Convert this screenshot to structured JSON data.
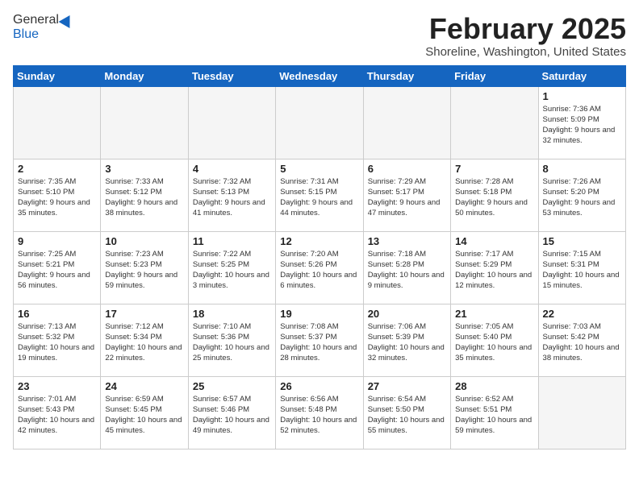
{
  "header": {
    "logo": {
      "general": "General",
      "blue": "Blue"
    },
    "title": "February 2025",
    "location": "Shoreline, Washington, United States"
  },
  "days_of_week": [
    "Sunday",
    "Monday",
    "Tuesday",
    "Wednesday",
    "Thursday",
    "Friday",
    "Saturday"
  ],
  "weeks": [
    [
      {
        "day": "",
        "info": ""
      },
      {
        "day": "",
        "info": ""
      },
      {
        "day": "",
        "info": ""
      },
      {
        "day": "",
        "info": ""
      },
      {
        "day": "",
        "info": ""
      },
      {
        "day": "",
        "info": ""
      },
      {
        "day": "1",
        "info": "Sunrise: 7:36 AM\nSunset: 5:09 PM\nDaylight: 9 hours and 32 minutes."
      }
    ],
    [
      {
        "day": "2",
        "info": "Sunrise: 7:35 AM\nSunset: 5:10 PM\nDaylight: 9 hours and 35 minutes."
      },
      {
        "day": "3",
        "info": "Sunrise: 7:33 AM\nSunset: 5:12 PM\nDaylight: 9 hours and 38 minutes."
      },
      {
        "day": "4",
        "info": "Sunrise: 7:32 AM\nSunset: 5:13 PM\nDaylight: 9 hours and 41 minutes."
      },
      {
        "day": "5",
        "info": "Sunrise: 7:31 AM\nSunset: 5:15 PM\nDaylight: 9 hours and 44 minutes."
      },
      {
        "day": "6",
        "info": "Sunrise: 7:29 AM\nSunset: 5:17 PM\nDaylight: 9 hours and 47 minutes."
      },
      {
        "day": "7",
        "info": "Sunrise: 7:28 AM\nSunset: 5:18 PM\nDaylight: 9 hours and 50 minutes."
      },
      {
        "day": "8",
        "info": "Sunrise: 7:26 AM\nSunset: 5:20 PM\nDaylight: 9 hours and 53 minutes."
      }
    ],
    [
      {
        "day": "9",
        "info": "Sunrise: 7:25 AM\nSunset: 5:21 PM\nDaylight: 9 hours and 56 minutes."
      },
      {
        "day": "10",
        "info": "Sunrise: 7:23 AM\nSunset: 5:23 PM\nDaylight: 9 hours and 59 minutes."
      },
      {
        "day": "11",
        "info": "Sunrise: 7:22 AM\nSunset: 5:25 PM\nDaylight: 10 hours and 3 minutes."
      },
      {
        "day": "12",
        "info": "Sunrise: 7:20 AM\nSunset: 5:26 PM\nDaylight: 10 hours and 6 minutes."
      },
      {
        "day": "13",
        "info": "Sunrise: 7:18 AM\nSunset: 5:28 PM\nDaylight: 10 hours and 9 minutes."
      },
      {
        "day": "14",
        "info": "Sunrise: 7:17 AM\nSunset: 5:29 PM\nDaylight: 10 hours and 12 minutes."
      },
      {
        "day": "15",
        "info": "Sunrise: 7:15 AM\nSunset: 5:31 PM\nDaylight: 10 hours and 15 minutes."
      }
    ],
    [
      {
        "day": "16",
        "info": "Sunrise: 7:13 AM\nSunset: 5:32 PM\nDaylight: 10 hours and 19 minutes."
      },
      {
        "day": "17",
        "info": "Sunrise: 7:12 AM\nSunset: 5:34 PM\nDaylight: 10 hours and 22 minutes."
      },
      {
        "day": "18",
        "info": "Sunrise: 7:10 AM\nSunset: 5:36 PM\nDaylight: 10 hours and 25 minutes."
      },
      {
        "day": "19",
        "info": "Sunrise: 7:08 AM\nSunset: 5:37 PM\nDaylight: 10 hours and 28 minutes."
      },
      {
        "day": "20",
        "info": "Sunrise: 7:06 AM\nSunset: 5:39 PM\nDaylight: 10 hours and 32 minutes."
      },
      {
        "day": "21",
        "info": "Sunrise: 7:05 AM\nSunset: 5:40 PM\nDaylight: 10 hours and 35 minutes."
      },
      {
        "day": "22",
        "info": "Sunrise: 7:03 AM\nSunset: 5:42 PM\nDaylight: 10 hours and 38 minutes."
      }
    ],
    [
      {
        "day": "23",
        "info": "Sunrise: 7:01 AM\nSunset: 5:43 PM\nDaylight: 10 hours and 42 minutes."
      },
      {
        "day": "24",
        "info": "Sunrise: 6:59 AM\nSunset: 5:45 PM\nDaylight: 10 hours and 45 minutes."
      },
      {
        "day": "25",
        "info": "Sunrise: 6:57 AM\nSunset: 5:46 PM\nDaylight: 10 hours and 49 minutes."
      },
      {
        "day": "26",
        "info": "Sunrise: 6:56 AM\nSunset: 5:48 PM\nDaylight: 10 hours and 52 minutes."
      },
      {
        "day": "27",
        "info": "Sunrise: 6:54 AM\nSunset: 5:50 PM\nDaylight: 10 hours and 55 minutes."
      },
      {
        "day": "28",
        "info": "Sunrise: 6:52 AM\nSunset: 5:51 PM\nDaylight: 10 hours and 59 minutes."
      },
      {
        "day": "",
        "info": ""
      }
    ]
  ]
}
